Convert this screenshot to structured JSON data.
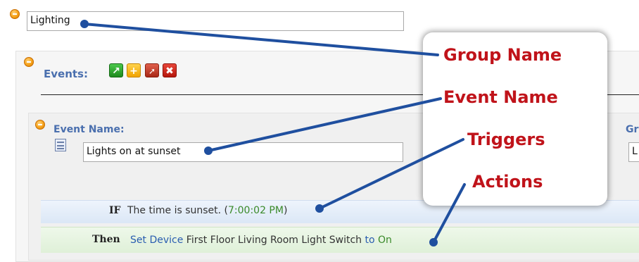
{
  "group": {
    "name_value": "Lighting"
  },
  "events": {
    "label": "Events:"
  },
  "event": {
    "name_label": "Event Name:",
    "name_value": "Lights on at sunset",
    "side_label_fragment": "Gr",
    "side_field_fragment": "L"
  },
  "if_row": {
    "keyword": "IF",
    "text": "The time is sunset.",
    "time_open": "(",
    "time_value": "7:00:02 PM",
    "time_close": ")"
  },
  "then_row": {
    "keyword": "Then",
    "action_link": "Set Device",
    "device": "First Floor Living Room Light Switch",
    "to_word": "to",
    "state": "On"
  },
  "callout": {
    "group_name": "Group Name",
    "event_name": "Event Name",
    "triggers": "Triggers",
    "actions": "Actions"
  },
  "icons": {
    "run": "run-icon",
    "add": "add-icon",
    "trigger": "cursor-icon",
    "delete": "delete-icon",
    "notes": "notes-icon"
  },
  "colors": {
    "label_blue": "#4a6fae",
    "callout_red": "#c0131a",
    "arrow_blue": "#1f4f9f",
    "time_green": "#3a8a2a",
    "link_blue": "#2a5db0"
  }
}
